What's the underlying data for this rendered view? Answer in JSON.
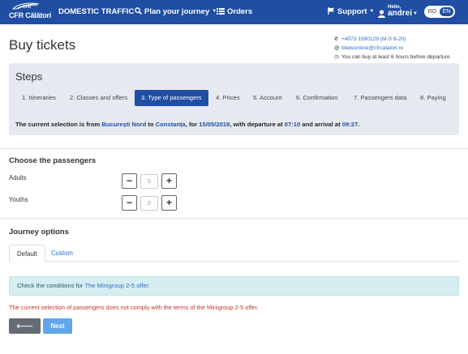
{
  "nav": {
    "logo_text": "CFR Călători",
    "domestic_traffic": "DOMESTIC TRAFFIC",
    "plan_journey": "Plan your journey",
    "orders": "Orders",
    "support": "Support",
    "user_hello": "Hello,",
    "user_name": "andrei",
    "lang_ro": "RO",
    "lang_en": "EN",
    "colors": {
      "bar": "#1f4ea3"
    }
  },
  "header": {
    "title": "Buy tickets",
    "phone": "+4073 1990129 (M-S 8-20)",
    "email": "bileteonline@cfrcalatori.ro",
    "notice": "You can buy at least 6 hours before departure"
  },
  "steps": {
    "title": "Steps",
    "items": [
      {
        "label": "1. Itineraries",
        "active": false
      },
      {
        "label": "2. Classes and offers",
        "active": false
      },
      {
        "label": "3. Type of passengers",
        "active": true
      },
      {
        "label": "4. Prices",
        "active": false
      },
      {
        "label": "5. Account",
        "active": false
      },
      {
        "label": "6. Confirmation",
        "active": false
      },
      {
        "label": "7. Passengers data",
        "active": false
      },
      {
        "label": "8. Paying",
        "active": false
      }
    ],
    "selection": {
      "prefix": "The current selection is from",
      "from": "București Nord",
      "to_word": "to",
      "to": "Constanța",
      "for_word": ", for",
      "date": "15/05/2019",
      "departure_word": ", with departure at",
      "departure": "07:10",
      "arrival_word": "and arrival at",
      "arrival": "09:27",
      "end": "."
    }
  },
  "passengers": {
    "title": "Choose the passengers",
    "adults_label": "Adults",
    "adults_value": "0",
    "youths_label": "Youths",
    "youths_value": "0"
  },
  "journey_options": {
    "title": "Journey options",
    "tabs": [
      "Default",
      "Custom"
    ],
    "info_prefix": "Check the conditions for",
    "info_link": "The Minigroup 2-5 offer.",
    "error": "The current selection of passengers does not comply with the terms of the Minigroup 2-5 offer."
  },
  "buttons": {
    "back": "Back",
    "next": "Next"
  }
}
